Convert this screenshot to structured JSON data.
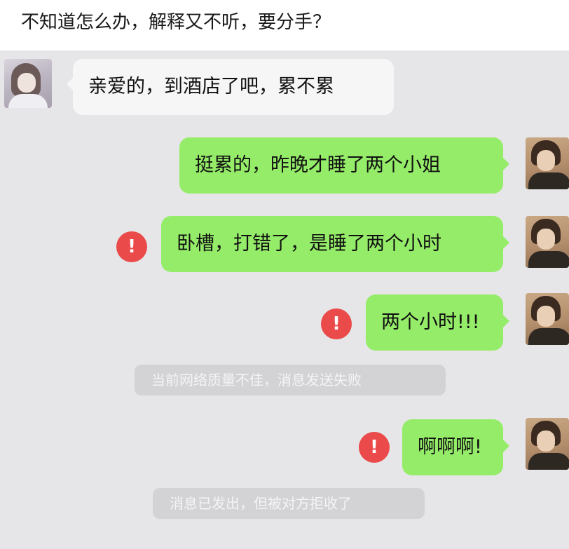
{
  "post_title": "不知道怎么办，解释又不听，要分手？",
  "chat": {
    "messages": [
      {
        "sender": "her",
        "text": "亲爱的，到酒店了吧，累不累",
        "failed": false
      },
      {
        "sender": "me",
        "text": "挺累的，昨晚才睡了两个小姐",
        "failed": false
      },
      {
        "sender": "me",
        "text": "卧槽，打错了，是睡了两个小时",
        "failed": true
      },
      {
        "sender": "me",
        "text": "两个小时!!!",
        "failed": true
      },
      {
        "sender": "system",
        "text": "当前网络质量不佳，消息发送失败"
      },
      {
        "sender": "me",
        "text": "啊啊啊!",
        "failed": true
      },
      {
        "sender": "system",
        "text": "消息已发出，但被对方拒收了"
      }
    ],
    "error_glyph": "!",
    "colors": {
      "background": "#e6e6e8",
      "my_bubble": "#95ec69",
      "their_bubble": "#f6f6f7",
      "error": "#ea4a4a"
    }
  }
}
